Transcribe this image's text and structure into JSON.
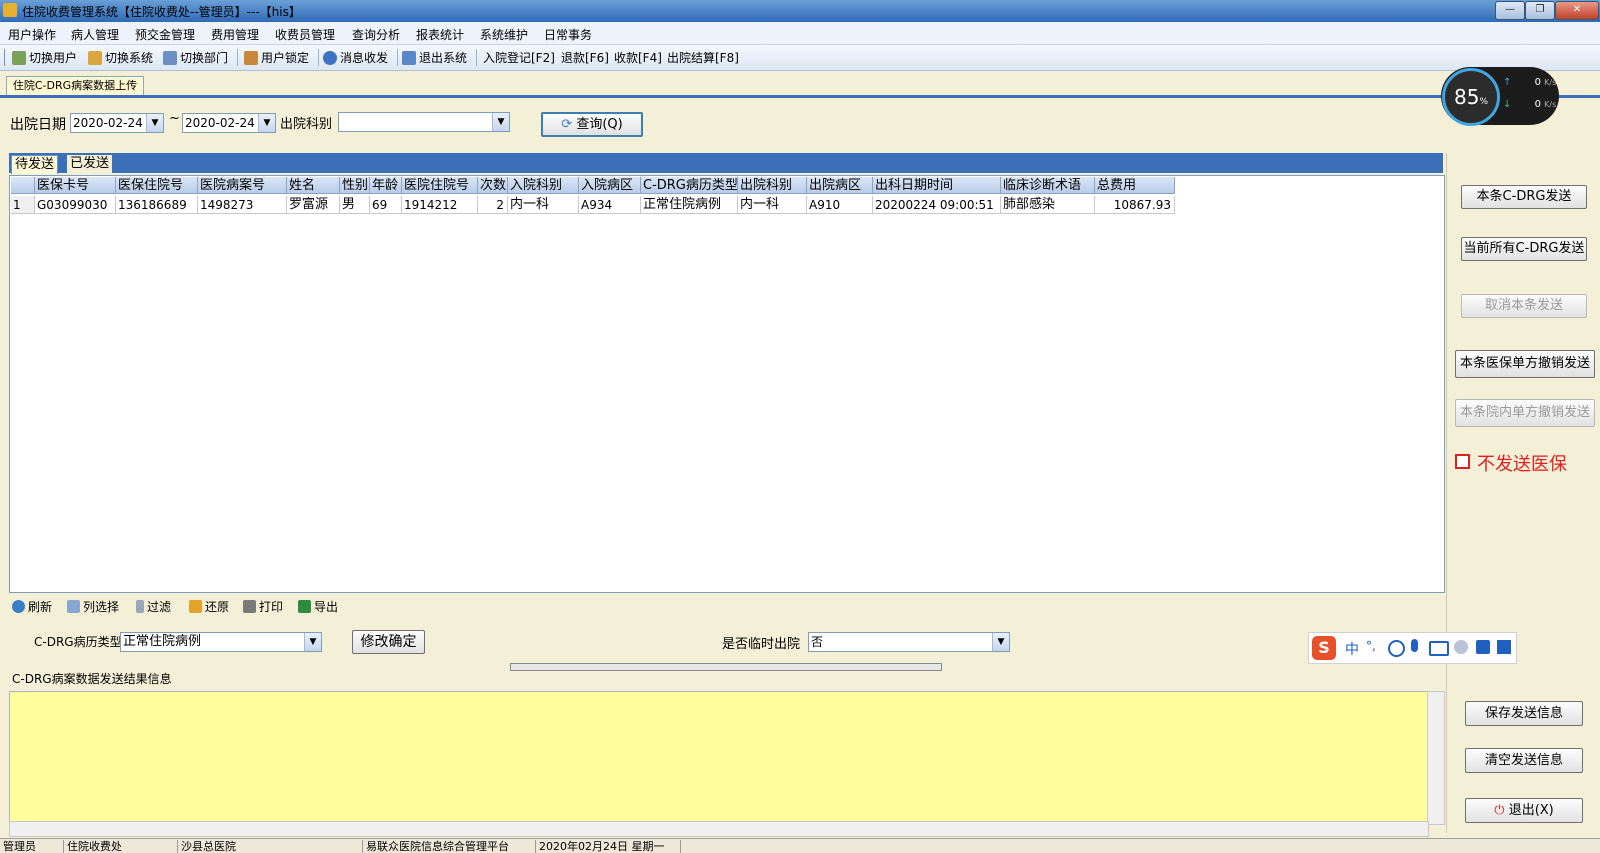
{
  "window": {
    "title": "住院收费管理系统【住院收费处--管理员】---【his】",
    "controls": [
      "—",
      "❐",
      "✕"
    ]
  },
  "menu": [
    "用户操作",
    "病人管理",
    "预交金管理",
    "费用管理",
    "收费员管理",
    "查询分析",
    "报表统计",
    "系统维护",
    "日常事务"
  ],
  "toolbar": [
    {
      "label": "切换用户",
      "icon": "users-icon"
    },
    {
      "label": "切换系统",
      "icon": "switch-system-icon"
    },
    {
      "label": "切换部门",
      "icon": "department-icon"
    },
    {
      "label": "用户锁定",
      "icon": "lock-icon"
    },
    {
      "label": "消息收发",
      "icon": "info-icon"
    },
    {
      "label": "退出系统",
      "icon": "exit-icon"
    },
    {
      "label": "入院登记[F2]"
    },
    {
      "label": "退款[F6]"
    },
    {
      "label": "收款[F4]"
    },
    {
      "label": "出院结算[F8]"
    }
  ],
  "doc_tab": "住院C-DRG病案数据上传",
  "filter": {
    "discharge_date_label": "出院日期",
    "date_from": "2020-02-24",
    "range_sep": "~",
    "date_to": "2020-02-24",
    "dept_label": "出院科别",
    "dept_value": "",
    "query_button": "查询(Q)"
  },
  "grid": {
    "tabs": [
      "待发送",
      "已发送"
    ],
    "columns": [
      "医保卡号",
      "医保住院号",
      "医院病案号",
      "姓名",
      "性别",
      "年龄",
      "医院住院号",
      "次数",
      "入院科别",
      "入院病区",
      "C-DRG病历类型",
      "出院科别",
      "出院病区",
      "出科日期时间",
      "临床诊断术语",
      "总费用"
    ],
    "rows": [
      {
        "index": "1",
        "cells": [
          "G03099030",
          "136186689",
          "1498273",
          "罗富源",
          "男",
          "69",
          "1914212",
          "2",
          "内一科",
          "A934",
          "正常住院病例",
          "内一科",
          "A910",
          "20200224 09:00:51",
          "肺部感染",
          "10867.93"
        ]
      }
    ]
  },
  "bottom_tools": [
    {
      "label": "刷新",
      "icon": "refresh-icon"
    },
    {
      "label": "列选择",
      "icon": "columns-icon"
    },
    {
      "label": "过滤",
      "icon": "filter-icon"
    },
    {
      "label": "还原",
      "icon": "undo-icon"
    },
    {
      "label": "打印",
      "icon": "print-icon"
    },
    {
      "label": "导出",
      "icon": "excel-export-icon"
    }
  ],
  "edit": {
    "type_label": "C-DRG病历类型",
    "type_value": "正常住院病例",
    "confirm_button": "修改确定",
    "temp_label": "是否临时出院",
    "temp_value": "否"
  },
  "result": {
    "label": "C-DRG病案数据发送结果信息",
    "text": ""
  },
  "right_panel": {
    "send_one": "本条C-DRG发送",
    "send_all": "当前所有C-DRG发送",
    "cancel_one": "取消本条发送",
    "revoke_insurance": "本条医保单方撤销发送",
    "revoke_hospital": "本条院内单方撤销发送",
    "no_insurance_label": "不发送医保",
    "save_info": "保存发送信息",
    "clear_info": "清空发送信息",
    "exit": "退出(X)"
  },
  "speed_widget": {
    "percent": "85",
    "unit": "%",
    "up": "0",
    "down": "0",
    "rate_unit": "K/s"
  },
  "ime_bar": {
    "lang": "中",
    "punct": "°,"
  },
  "status_bar": [
    "管理员",
    "住院收费处",
    "沙县总医院",
    "易联众医院信息综合管理平台",
    "2020年02月24日 星期一"
  ],
  "colors": {
    "accent": "#3b6fb8",
    "result_bg": "#ffff9e",
    "warning": "#e02020"
  }
}
